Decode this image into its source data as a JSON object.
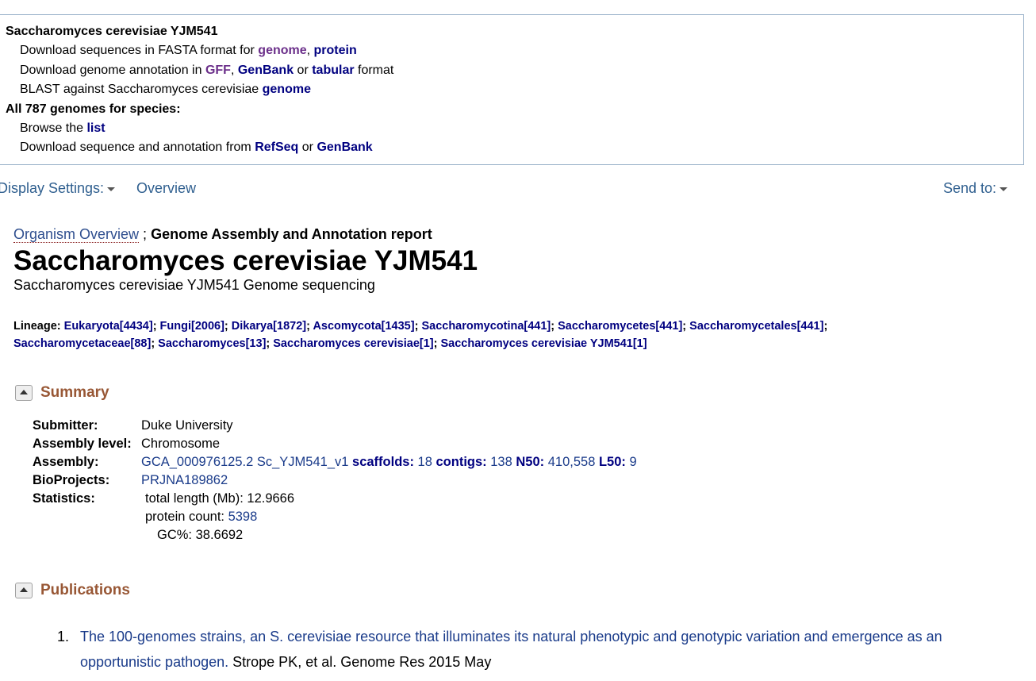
{
  "topbox": {
    "organism": "Saccharomyces cerevisiae YJM541",
    "fasta_prefix": "Download sequences in FASTA format for ",
    "genome_link": "genome",
    "comma": ", ",
    "protein_link": "protein",
    "annot_prefix": "Download genome annotation in ",
    "gff_link": "GFF",
    "comma2": ", ",
    "genbank_link": "GenBank",
    "or_text": " or ",
    "tabular_link": "tabular",
    "format_text": " format",
    "blast_prefix": "BLAST against Saccharomyces cerevisiae ",
    "blast_genome_link": "genome",
    "all_genomes": "All 787 genomes for species:",
    "browse_prefix": "Browse the ",
    "list_link": "list",
    "dl_prefix": "Download sequence and annotation from ",
    "refseq_link": "RefSeq",
    "or_text2": " or ",
    "genbank2_link": "GenBank"
  },
  "display_bar": {
    "display_settings": "Display Settings:",
    "overview": "Overview",
    "send_to": "Send to:"
  },
  "header": {
    "organism_overview": "Organism Overview",
    "separator": " ; ",
    "report": "Genome Assembly and Annotation report",
    "title": "Saccharomyces cerevisiae YJM541",
    "subtitle": "Saccharomyces cerevisiae YJM541 Genome sequencing"
  },
  "lineage": {
    "label": "Lineage: ",
    "items": [
      "Eukaryota[4434]",
      "Fungi[2006]",
      "Dikarya[1872]",
      "Ascomycota[1435]",
      "Saccharomycotina[441]",
      "Saccharomycetes[441]",
      "Saccharomycetales[441]",
      "Saccharomycetaceae[88]",
      "Saccharomyces[13]",
      "Saccharomyces cerevisiae[1]",
      "Saccharomyces cerevisiae YJM541[1]"
    ]
  },
  "summary": {
    "heading": "Summary",
    "submitter_label": "Submitter:",
    "submitter": "Duke University",
    "level_label": "Assembly level:",
    "level": "Chromosome",
    "assembly_label": "Assembly:",
    "assembly_link": "GCA_000976125.2 Sc_YJM541_v1",
    "scaffolds_label": " scaffolds:",
    "scaffolds": " 18",
    "contigs_label": " contigs:",
    "contigs": " 138",
    "n50_label": " N50:",
    "n50": " 410,558",
    "l50_label": " L50:",
    "l50": " 9",
    "bioprojects_label": "BioProjects:",
    "bioproject": "PRJNA189862",
    "statistics_label": "Statistics:",
    "total_length_label": "total length (Mb): ",
    "total_length": "12.9666",
    "protein_count_label": "protein count: ",
    "protein_count": "5398",
    "gc_label": "GC%: ",
    "gc": "38.6692"
  },
  "publications": {
    "heading": "Publications",
    "items": [
      {
        "num": "1.",
        "title": "The 100-genomes strains, an S. cerevisiae resource that illuminates its natural phenotypic and genotypic variation and emergence as an opportunistic pathogen.",
        "citation": " Strope PK, et al. Genome Res 2015 May"
      }
    ]
  }
}
